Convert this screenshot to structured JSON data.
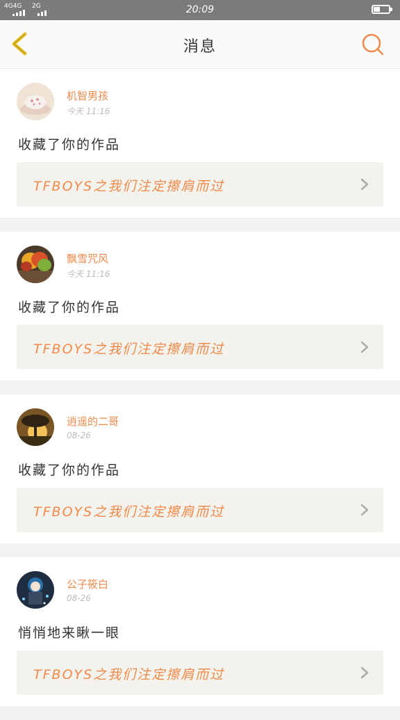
{
  "statusbar": {
    "network1": "4G4G",
    "network2": "2G",
    "time": "20:09",
    "battery_level": 0.45
  },
  "header": {
    "title": "消息",
    "back_icon": "chevron-left-icon",
    "search_icon": "search-icon"
  },
  "notifications": [
    {
      "name": "机智男孩",
      "time": "今天 11:16",
      "action": "收藏了你的作品",
      "work": "TFBOYS之我们注定擦肩而过"
    },
    {
      "name": "飘雪咒风",
      "time": "今天 11:16",
      "action": "收藏了你的作品",
      "work": "TFBOYS之我们注定擦肩而过"
    },
    {
      "name": "逍遥的二哥",
      "time": "08-26",
      "action": "收藏了你的作品",
      "work": "TFBOYS之我们注定擦肩而过"
    },
    {
      "name": "公子筱白",
      "time": "08-26",
      "action": "悄悄地来瞅一眼",
      "work": "TFBOYS之我们注定擦肩而过"
    }
  ],
  "colors": {
    "accent": "#f08a4b",
    "back_icon": "#e8c12a",
    "card_bg": "#f3f2ec"
  }
}
